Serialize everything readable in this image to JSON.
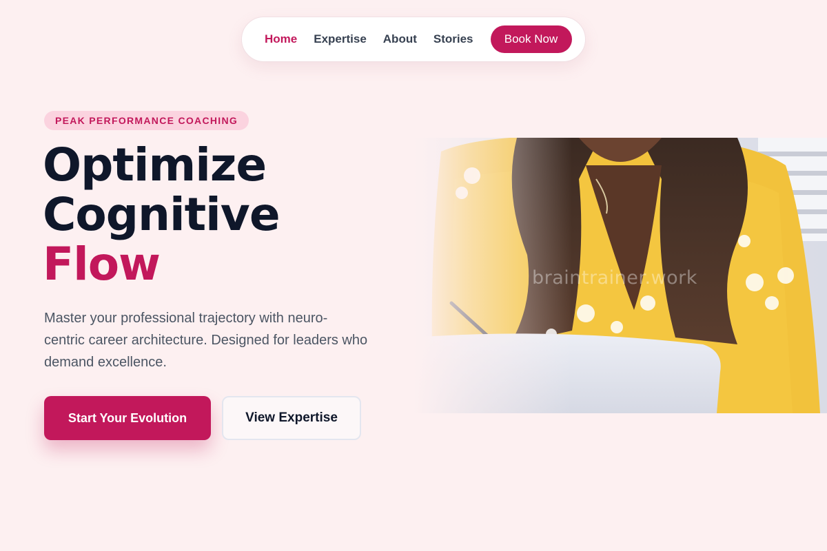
{
  "nav": {
    "links": [
      "Home",
      "Expertise",
      "About",
      "Stories"
    ],
    "active": "Home",
    "cta": "Book Now"
  },
  "hero": {
    "tagline": "PEAK PERFORMANCE COACHING",
    "headline_line1": "Optimize",
    "headline_line2": "Cognitive",
    "headline_accent": "Flow",
    "description": "Master your professional trajectory with neuro-centric career architecture. Designed for leaders who demand excellence.",
    "primary_cta": "Start Your Evolution",
    "secondary_cta": "View Expertise",
    "image_watermark": "braintrainer.work"
  },
  "colors": {
    "accent": "#c2185b",
    "heading": "#0f172a",
    "background": "#fdf0f1",
    "tagline_bg": "#fbd3df"
  }
}
